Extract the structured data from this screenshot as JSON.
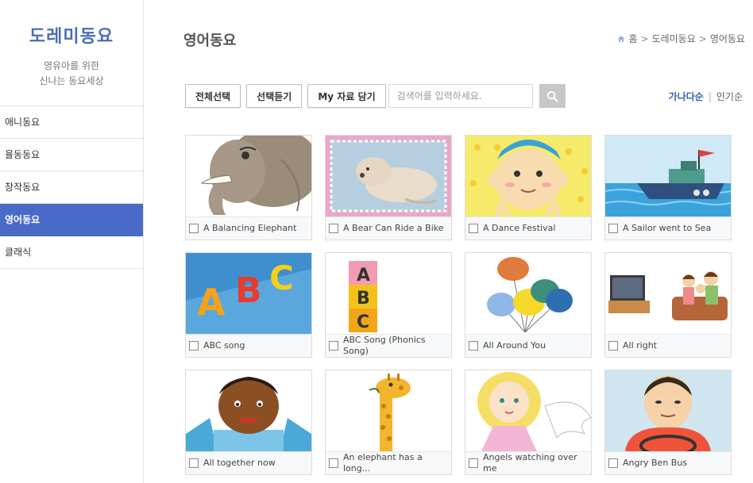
{
  "brand": {
    "title": "도레미동요",
    "subtitle_line1": "영유아를 위한",
    "subtitle_line2": "신나는 동요세상"
  },
  "sidebar": {
    "items": [
      {
        "label": "애니동요",
        "active": false
      },
      {
        "label": "율동동요",
        "active": false
      },
      {
        "label": "창작동요",
        "active": false
      },
      {
        "label": "영어동요",
        "active": true
      },
      {
        "label": "클래식",
        "active": false
      }
    ]
  },
  "header": {
    "title": "영어동요",
    "breadcrumb": {
      "home": "홈",
      "level1": "도레미동요",
      "level2": "영어동요",
      "separator": ">"
    }
  },
  "toolbar": {
    "select_all_label": "전체선택",
    "listen_selected_label": "선택듣기",
    "my_list_label": "My 자료 담기",
    "search_placeholder": "검색어를 입력하세요.",
    "search_icon": "search-icon"
  },
  "sort": {
    "alphabetical_label": "가나다순",
    "divider": "|",
    "popular_label": "인기순"
  },
  "colors": {
    "brand_blue": "#4a6db5",
    "active_menu": "#4a6ac8",
    "sort_active": "#3a5fb0",
    "search_button": "#c7c7c7"
  },
  "songs": [
    {
      "title": "A Balancing Elephant",
      "thumb": "elephant"
    },
    {
      "title": "A Bear Can Ride a Bike",
      "thumb": "bear"
    },
    {
      "title": "A Dance Festival",
      "thumb": "boy"
    },
    {
      "title": "A Sailor went to Sea",
      "thumb": "ship"
    },
    {
      "title": "ABC song",
      "thumb": "abc-letters"
    },
    {
      "title": "ABC Song (Phonics Song)",
      "thumb": "abc-blocks"
    },
    {
      "title": "All Around You",
      "thumb": "balloons"
    },
    {
      "title": "All right",
      "thumb": "family-tv"
    },
    {
      "title": "All together now",
      "thumb": "kid"
    },
    {
      "title": "An elephant has a long...",
      "thumb": "giraffe"
    },
    {
      "title": "Angels watching over me",
      "thumb": "angel"
    },
    {
      "title": "Angry Ben Bus",
      "thumb": "bus-driver"
    }
  ]
}
